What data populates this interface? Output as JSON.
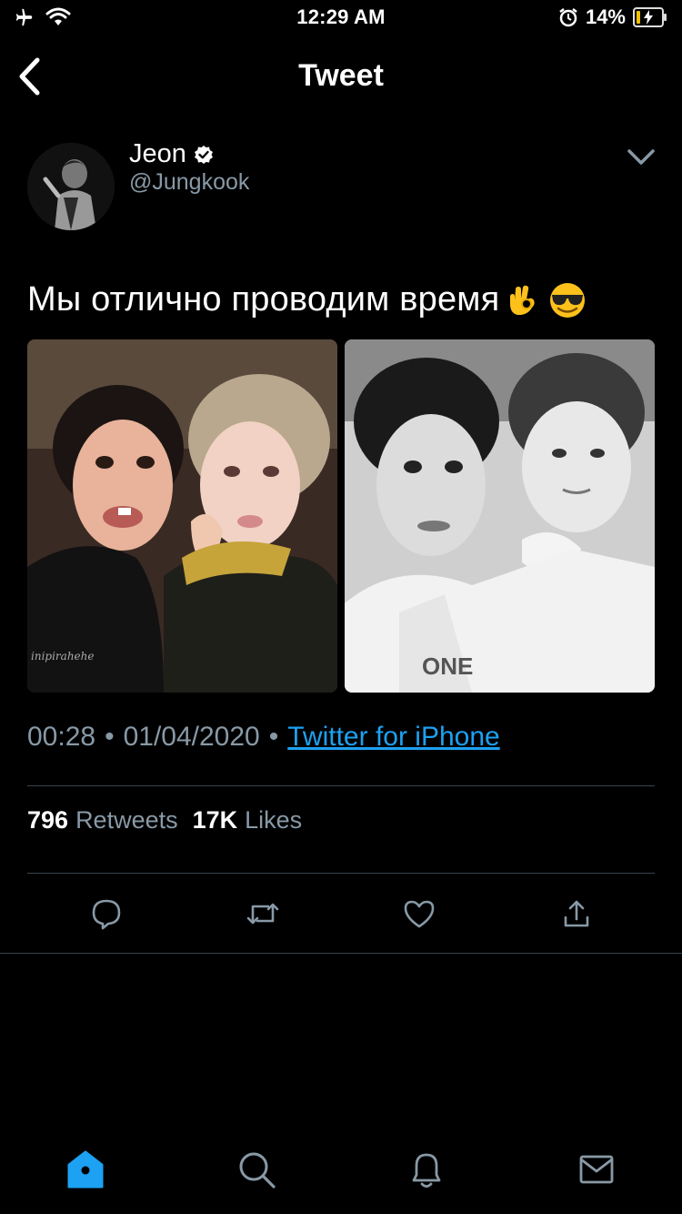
{
  "status_bar": {
    "time": "12:29 AM",
    "battery_percent": "14%",
    "battery_level": 0.14,
    "icons": [
      "airplane-icon",
      "wifi-icon",
      "alarm-icon",
      "battery-charging-icon"
    ]
  },
  "nav": {
    "title": "Tweet",
    "back_icon": "chevron-left-icon"
  },
  "tweet": {
    "author": {
      "display_name": "Jeon",
      "handle": "@Jungkook",
      "verified": true
    },
    "text": "Мы отлично проводим время",
    "emojis": [
      "ok-hand-emoji",
      "sunglasses-face-emoji"
    ],
    "media": [
      {
        "description": "photo-1",
        "watermark": "inipirahehe"
      },
      {
        "description": "photo-2",
        "shirt_text": "ONE"
      }
    ],
    "time": "00:28",
    "date": "01/04/2020",
    "source": "Twitter for iPhone",
    "separator": "•",
    "retweets_count": "796",
    "retweets_label": "Retweets",
    "likes_count": "17K",
    "likes_label": "Likes"
  },
  "actions": [
    "reply-icon",
    "retweet-icon",
    "like-icon",
    "share-icon"
  ],
  "tab_bar": {
    "items": [
      "home-icon",
      "search-icon",
      "notifications-icon",
      "messages-icon"
    ],
    "active": "home-icon"
  },
  "colors": {
    "background": "#000000",
    "accent": "#1da1f2",
    "secondary_text": "#8899a6",
    "divider": "#38444d",
    "icon": "#8899a6"
  }
}
